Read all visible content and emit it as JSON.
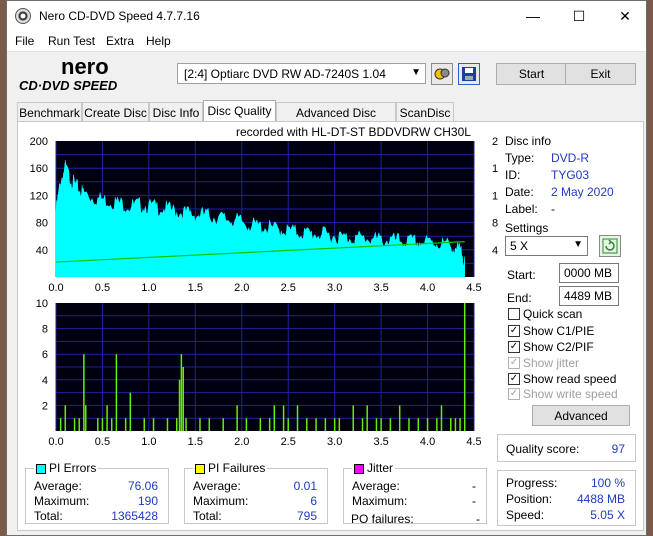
{
  "window": {
    "title": "Nero CD-DVD Speed 4.7.7.16",
    "minimize": "—",
    "maximize": "☐",
    "close": "✕"
  },
  "menu": [
    "File",
    "Run Test",
    "Extra",
    "Help"
  ],
  "logo": {
    "line1": "nero",
    "line2": "CD·DVD SPEED"
  },
  "toolbar": {
    "drive": "[2:4]   Optiarc DVD RW AD-7240S 1.04",
    "start_label": "Start",
    "exit_label": "Exit"
  },
  "tabs": [
    "Benchmark",
    "Create Disc",
    "Disc Info",
    "Disc Quality",
    "Advanced Disc Quality",
    "ScanDisc"
  ],
  "active_tab": "Disc Quality",
  "recorded_with": "recorded with HL-DT-ST BDDVDRW CH30L",
  "disc_info": {
    "title": "Disc info",
    "type_label": "Type:",
    "type": "DVD-R",
    "id_label": "ID:",
    "id": "TYG03",
    "date_label": "Date:",
    "date": "2 May 2020",
    "label_label": "Label:",
    "label": "-"
  },
  "settings": {
    "title": "Settings",
    "speed": "5 X",
    "start_label": "Start:",
    "start": "0000 MB",
    "end_label": "End:",
    "end": "4489 MB",
    "quick_scan": "Quick scan",
    "show_c1pie": "Show C1/PIE",
    "show_c2pif": "Show C2/PIF",
    "show_jitter": "Show jitter",
    "show_read_speed": "Show read speed",
    "show_write_speed": "Show write speed",
    "advanced_label": "Advanced"
  },
  "quality": {
    "label": "Quality score:",
    "value": "97"
  },
  "progress": {
    "progress_label": "Progress:",
    "progress": "100 %",
    "position_label": "Position:",
    "position": "4488 MB",
    "speed_label": "Speed:",
    "speed": "5.05 X"
  },
  "pi_errors": {
    "title": "PI Errors",
    "avg_label": "Average:",
    "avg": "76.06",
    "max_label": "Maximum:",
    "max": "190",
    "total_label": "Total:",
    "total": "1365428"
  },
  "pi_failures": {
    "title": "PI Failures",
    "avg_label": "Average:",
    "avg": "0.01",
    "max_label": "Maximum:",
    "max": "6",
    "total_label": "Total:",
    "total": "795"
  },
  "jitter": {
    "title": "Jitter",
    "avg_label": "Average:",
    "avg": "-",
    "max_label": "Maximum:",
    "max": "-",
    "po_label": "PO failures:",
    "po": "-"
  },
  "colors": {
    "pi_errors": "#00ffff",
    "pi_failures": "#ffff00",
    "jitter": "#ff00ff",
    "read_speed": "#00cc00",
    "plot_bg": "#000010",
    "grid": "#2020a0"
  },
  "chart_data": [
    {
      "type": "area",
      "series": [
        {
          "name": "PI Errors",
          "x": [
            0.0,
            0.05,
            0.1,
            0.15,
            0.2,
            0.25,
            0.3,
            0.4,
            0.5,
            0.6,
            0.7,
            0.8,
            0.9,
            1.0,
            1.1,
            1.2,
            1.3,
            1.4,
            1.5,
            1.6,
            1.7,
            1.8,
            1.9,
            2.0,
            2.1,
            2.2,
            2.3,
            2.4,
            2.5,
            2.6,
            2.7,
            2.8,
            2.9,
            3.0,
            3.1,
            3.2,
            3.3,
            3.4,
            3.5,
            3.6,
            3.7,
            3.8,
            3.9,
            4.0,
            4.1,
            4.2,
            4.3,
            4.35,
            4.4
          ],
          "values": [
            100,
            145,
            165,
            150,
            140,
            132,
            128,
            120,
            118,
            115,
            112,
            108,
            110,
            108,
            106,
            104,
            100,
            98,
            95,
            96,
            92,
            90,
            88,
            85,
            80,
            78,
            76,
            74,
            72,
            70,
            68,
            67,
            66,
            64,
            62,
            62,
            61,
            60,
            58,
            58,
            57,
            56,
            55,
            55,
            54,
            52,
            48,
            42,
            30
          ]
        },
        {
          "name": "Read Speed",
          "x": [
            0.0,
            4.4
          ],
          "values": [
            2.2,
            5.2
          ]
        }
      ],
      "xlim": [
        0,
        4.5
      ],
      "ylim": [
        0,
        200
      ],
      "y2lim": [
        0,
        20
      ],
      "xticks": [
        "0.0",
        "0.5",
        "1.0",
        "1.5",
        "2.0",
        "2.5",
        "3.0",
        "3.5",
        "4.0",
        "4.5"
      ],
      "yticks": [
        "200",
        "160",
        "120",
        "80",
        "40"
      ],
      "y2ticks": [
        "20",
        "16",
        "12",
        "8",
        "4"
      ],
      "grid": true
    },
    {
      "type": "bar",
      "series": [
        {
          "name": "PI Failures",
          "x": [
            0.05,
            0.1,
            0.2,
            0.25,
            0.3,
            0.32,
            0.45,
            0.5,
            0.55,
            0.6,
            0.65,
            0.75,
            0.8,
            0.95,
            1.05,
            1.2,
            1.3,
            1.33,
            1.35,
            1.37,
            1.4,
            1.55,
            1.65,
            1.8,
            1.95,
            2.05,
            2.2,
            2.3,
            2.35,
            2.45,
            2.5,
            2.6,
            2.7,
            2.8,
            2.9,
            3.0,
            3.05,
            3.2,
            3.3,
            3.35,
            3.45,
            3.5,
            3.6,
            3.7,
            3.8,
            3.9,
            4.0,
            4.1,
            4.15,
            4.25,
            4.3,
            4.35,
            4.4
          ],
          "values": [
            1,
            2,
            1,
            1,
            6,
            2,
            1,
            1,
            2,
            1,
            6,
            1,
            3,
            1,
            1,
            1,
            1,
            4,
            6,
            5,
            1,
            1,
            1,
            1,
            2,
            1,
            1,
            1,
            2,
            2,
            1,
            2,
            1,
            1,
            1,
            1,
            1,
            2,
            1,
            2,
            1,
            1,
            1,
            2,
            1,
            1,
            1,
            1,
            2,
            1,
            1,
            1,
            10
          ]
        }
      ],
      "xlim": [
        0,
        4.5
      ],
      "ylim": [
        0,
        10
      ],
      "xticks": [
        "0.0",
        "0.5",
        "1.0",
        "1.5",
        "2.0",
        "2.5",
        "3.0",
        "3.5",
        "4.0",
        "4.5"
      ],
      "yticks": [
        "10",
        "8",
        "6",
        "4",
        "2"
      ],
      "grid": true
    }
  ]
}
